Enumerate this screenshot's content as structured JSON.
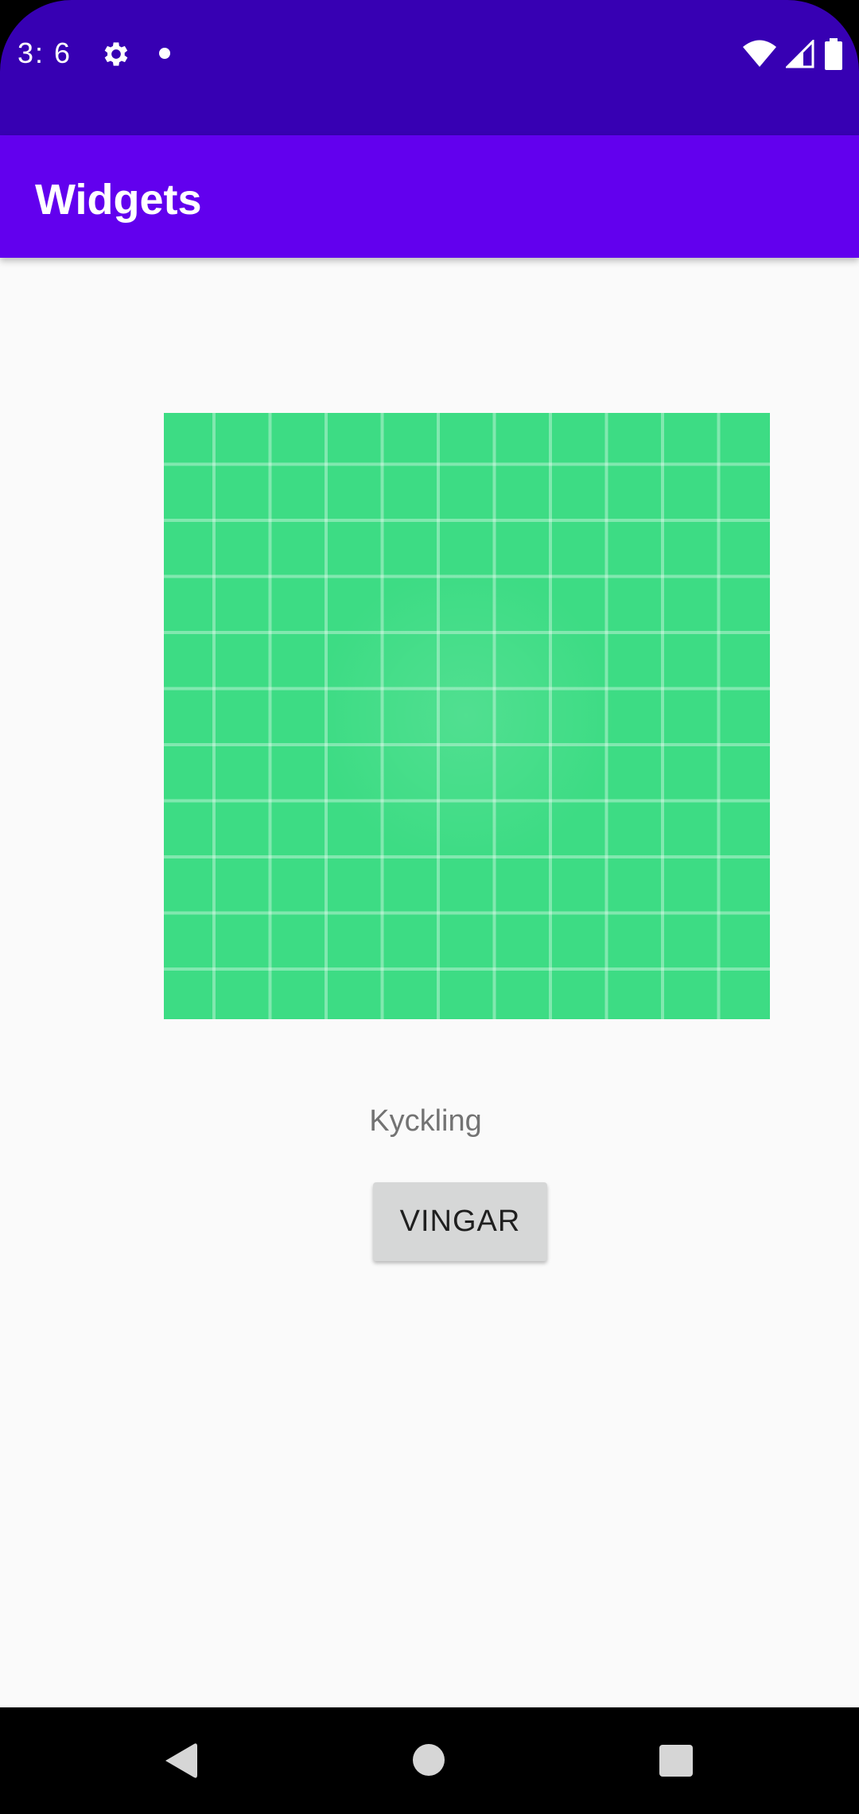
{
  "status_bar": {
    "time": "3:  6",
    "left_icons": [
      "gear-icon",
      "notification-dot-icon"
    ],
    "right_icons": [
      "wifi-icon",
      "signal-icon",
      "battery-icon"
    ],
    "background_color": "#3700b3"
  },
  "app_bar": {
    "title": "Widgets",
    "background_color": "#6200ee"
  },
  "main": {
    "image_description_icon": "green-grid-image",
    "image_color": "#3ddc84",
    "label": "Kyckling",
    "button_label": "VINGAR"
  },
  "nav_bar": {
    "icons": [
      "back-icon",
      "home-icon",
      "recents-icon"
    ]
  }
}
